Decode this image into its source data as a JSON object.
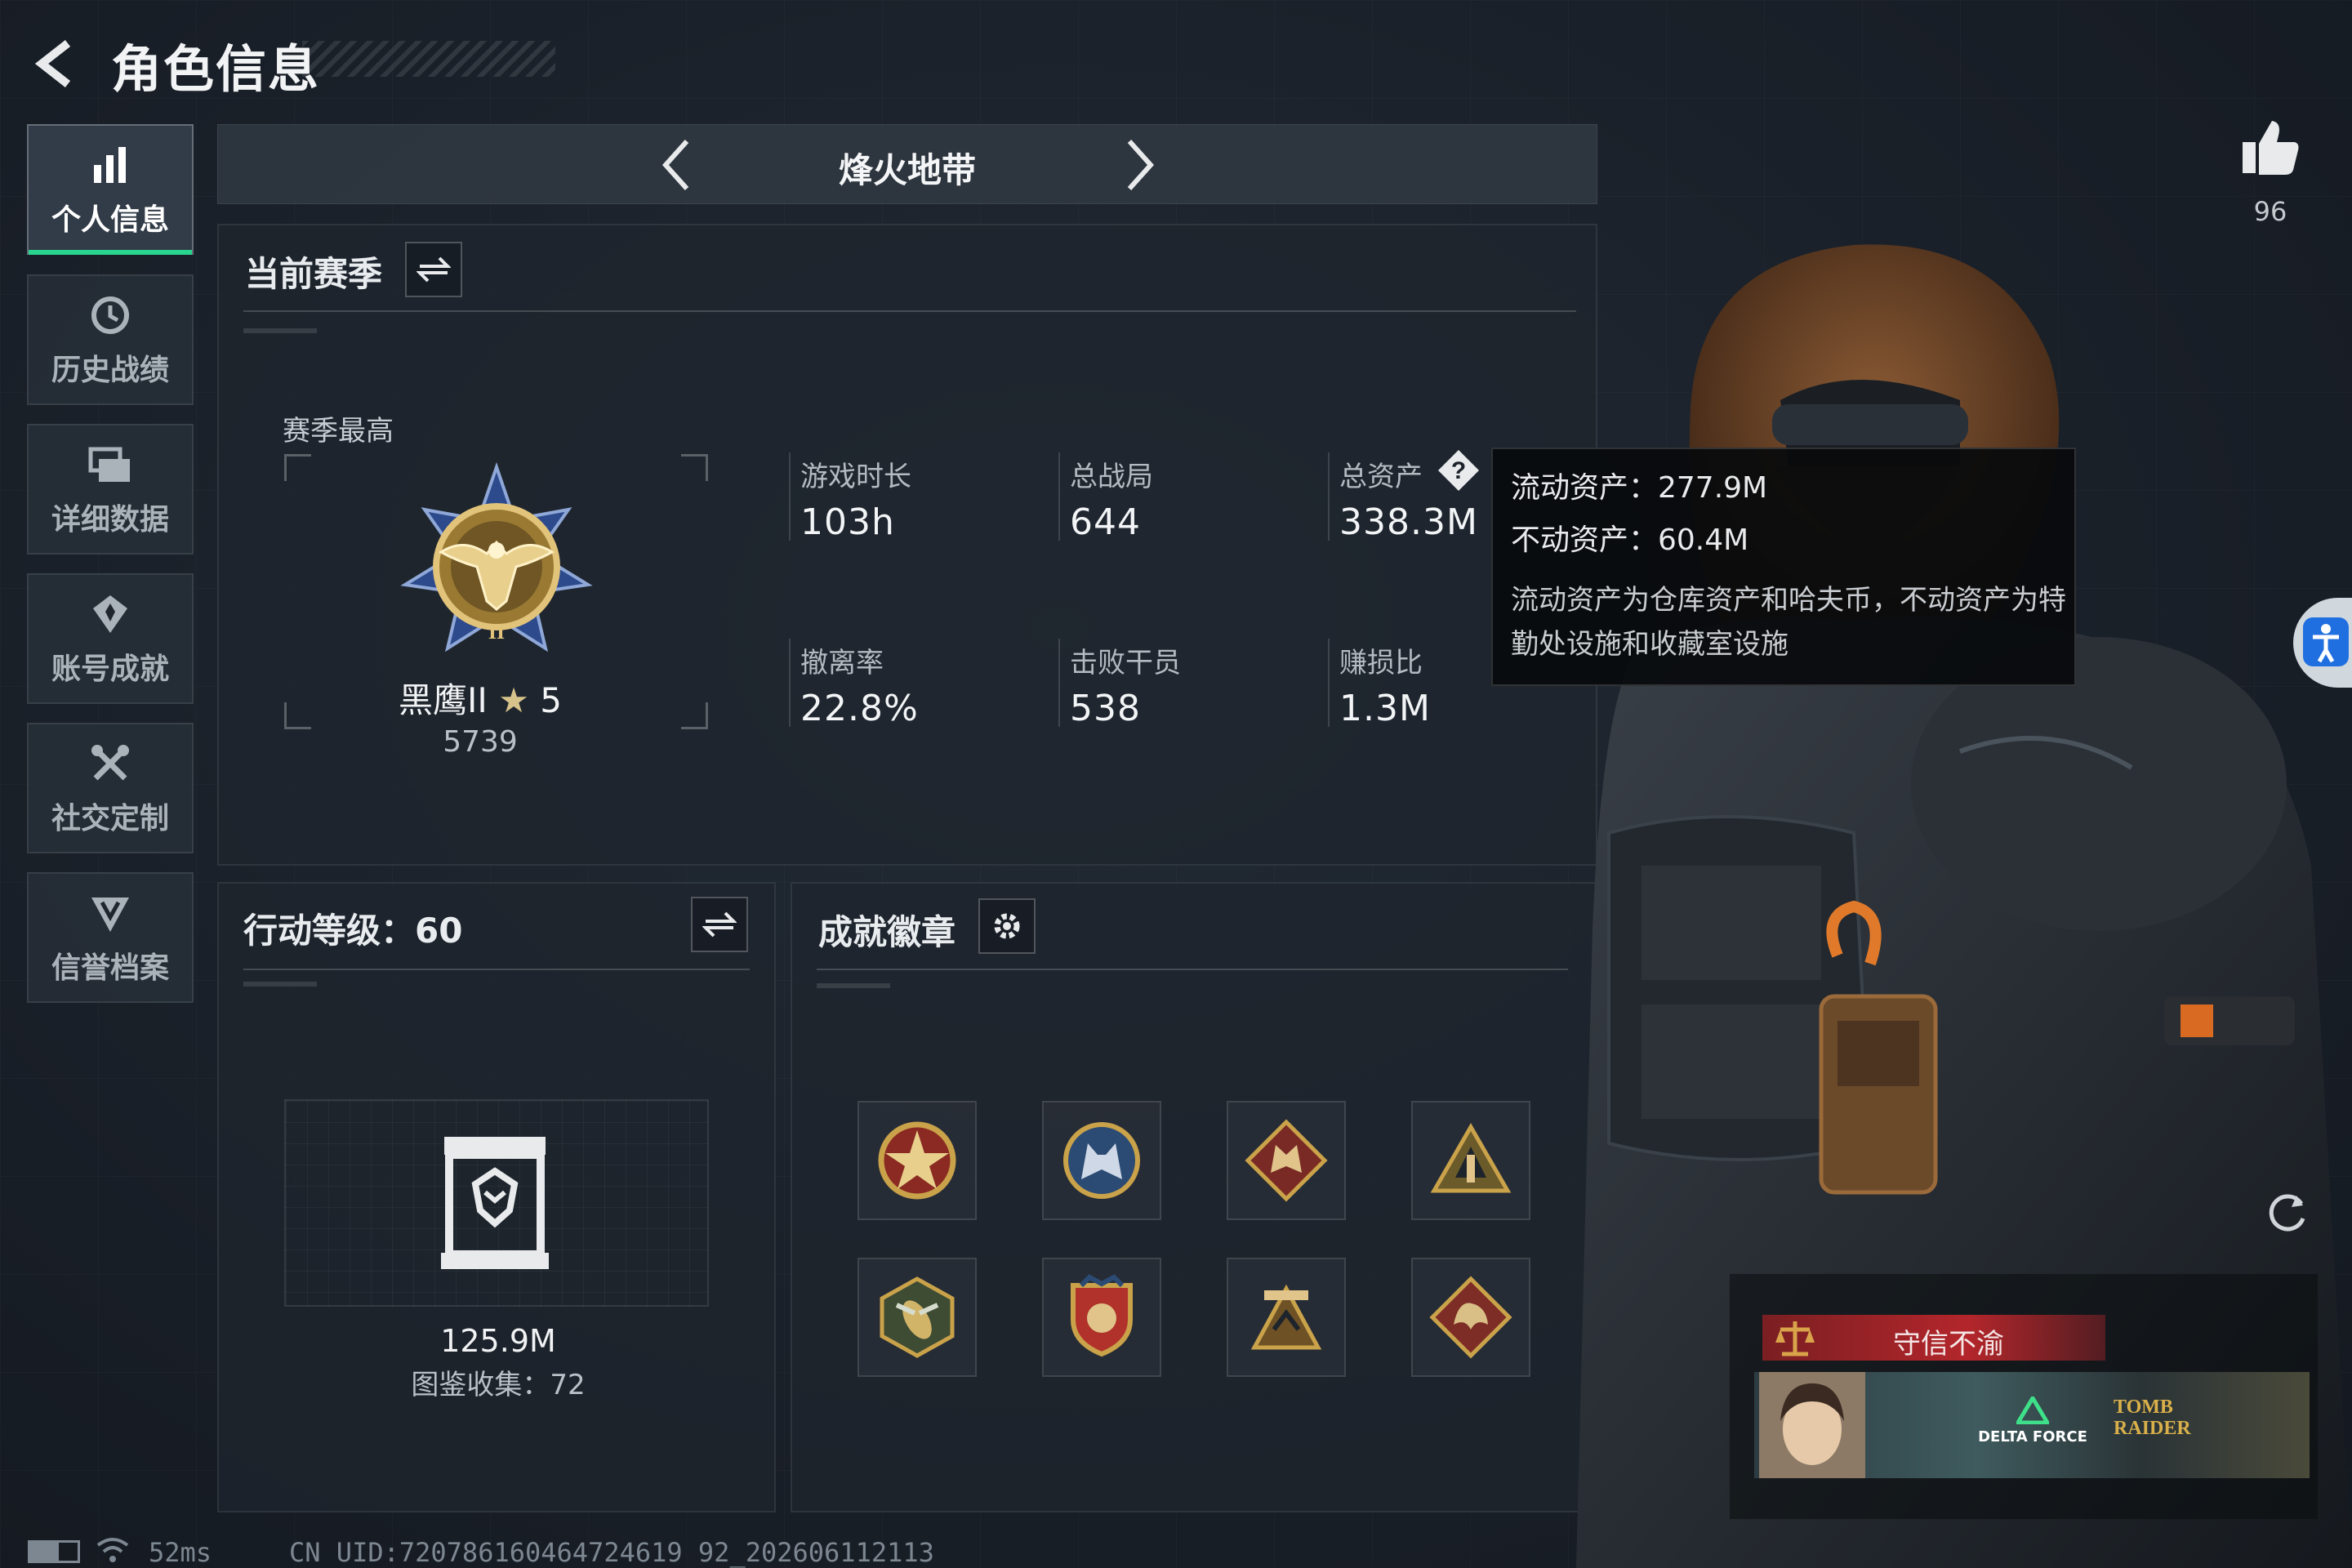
{
  "header": {
    "title": "角色信息"
  },
  "sidebar": {
    "items": [
      {
        "label": "个人信息",
        "icon": "bar-chart-icon",
        "active": true
      },
      {
        "label": "历史战绩",
        "icon": "history-icon"
      },
      {
        "label": "详细数据",
        "icon": "folder-icon"
      },
      {
        "label": "账号成就",
        "icon": "achievement-icon"
      },
      {
        "label": "社交定制",
        "icon": "tools-icon"
      },
      {
        "label": "信誉档案",
        "icon": "shield-icon"
      }
    ]
  },
  "mode": {
    "name": "烽火地带"
  },
  "season": {
    "title": "当前赛季",
    "best_label": "赛季最高",
    "rank_name": "黑鹰II",
    "rank_stars": "5",
    "rank_points": "5739",
    "stats": [
      {
        "label": "游戏时长",
        "value": "103h"
      },
      {
        "label": "总战局",
        "value": "644"
      },
      {
        "label": "总资产",
        "value": "338.3M"
      },
      {
        "label": "撤离率",
        "value": "22.8%"
      },
      {
        "label": "击败干员",
        "value": "538"
      },
      {
        "label": "赚损比",
        "value": "1.3M"
      }
    ]
  },
  "tooltip": {
    "liquid": "流动资产：277.9M",
    "fixed": "不动资产：60.4M",
    "desc": "流动资产为仓库资产和哈夫币，不动资产为特勤处设施和收藏室设施"
  },
  "action_level": {
    "title": "行动等级：60",
    "value": "125.9M",
    "collection": "图鉴收集：72"
  },
  "achievements": {
    "title": "成就徽章",
    "badges": [
      "star-medal-icon",
      "wolf-emblem-icon",
      "beast-diamond-icon",
      "pyramid-badge-icon",
      "wasp-hex-icon",
      "crest-shield-icon",
      "eagle-tower-icon",
      "dragon-diamond-icon"
    ]
  },
  "right": {
    "likes": "96"
  },
  "profile_card": {
    "tag": "守信不渝",
    "banner_left": "DELTA FORCE",
    "banner_right": "TOMB RAIDER"
  },
  "footer": {
    "ping": "52ms",
    "uid": "CN UID:720786160464724619 92_202606112113"
  },
  "colors": {
    "accent_green": "#29d48e",
    "tag_red": "#b3262b",
    "gold": "#c9a24a"
  }
}
